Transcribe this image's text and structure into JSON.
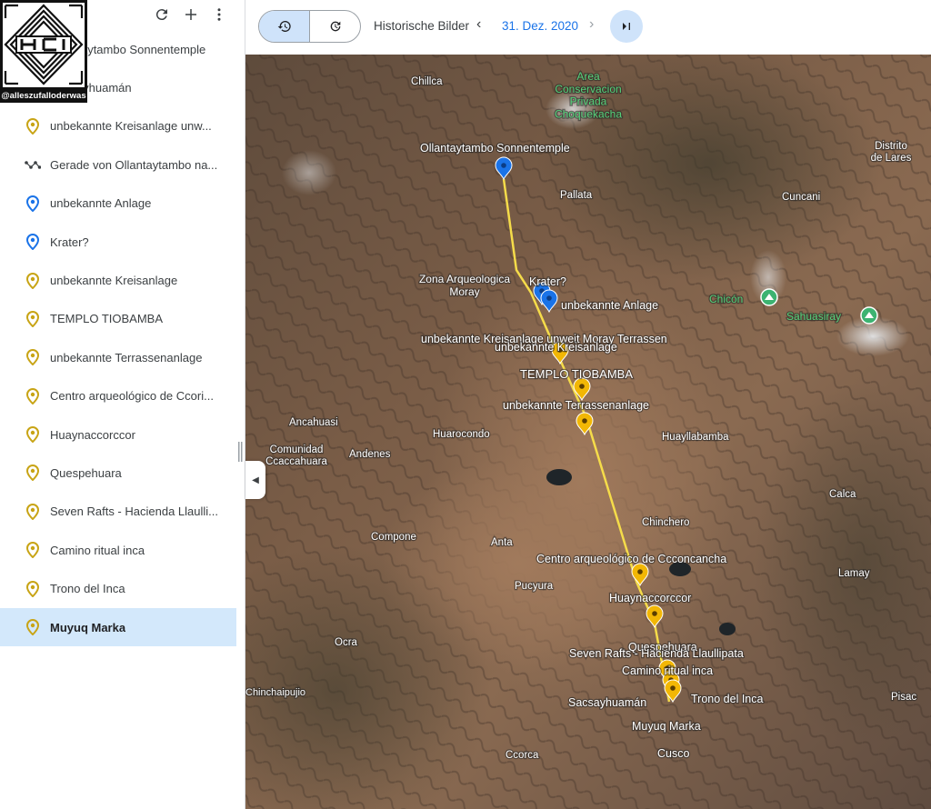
{
  "sidebar": {
    "toolbar": {
      "refresh_icon": "refresh-icon",
      "add_icon": "plus-icon",
      "more_icon": "more-vert-icon"
    },
    "items": [
      {
        "label": "Ollantaytambo Sonnentemple",
        "icon": "pin-icon",
        "color": "#c8a415"
      },
      {
        "label": "Sacsayhuamán",
        "icon": "pin-icon",
        "color": "#c8a415"
      },
      {
        "label": "unbekannte Kreisanlage unw...",
        "icon": "pin-icon",
        "color": "#c8a415"
      },
      {
        "label": "Gerade von Ollantaytambo na...",
        "icon": "path-icon",
        "color": "#3c4043"
      },
      {
        "label": "unbekannte Anlage",
        "icon": "pin-icon",
        "color": "#1a73e8"
      },
      {
        "label": "Krater?",
        "icon": "pin-icon",
        "color": "#1a73e8"
      },
      {
        "label": "unbekannte Kreisanlage",
        "icon": "pin-icon",
        "color": "#c8a415"
      },
      {
        "label": "TEMPLO TIOBAMBA",
        "icon": "pin-icon",
        "color": "#c8a415"
      },
      {
        "label": "unbekannte Terrassenanlage",
        "icon": "pin-icon",
        "color": "#c8a415"
      },
      {
        "label": "Centro arqueológico de Ccori...",
        "icon": "pin-icon",
        "color": "#c8a415"
      },
      {
        "label": "Huaynaccorccor",
        "icon": "pin-icon",
        "color": "#c8a415"
      },
      {
        "label": "Quespehuara",
        "icon": "pin-icon",
        "color": "#c8a415"
      },
      {
        "label": "Seven Rafts - Hacienda Llaulli...",
        "icon": "pin-icon",
        "color": "#c8a415"
      },
      {
        "label": "Camino ritual inca",
        "icon": "pin-icon",
        "color": "#c8a415"
      },
      {
        "label": "Trono del Inca",
        "icon": "pin-icon",
        "color": "#c8a415"
      },
      {
        "label": "Muyuq Marka",
        "icon": "pin-icon",
        "color": "#c8a415",
        "selected": true
      }
    ]
  },
  "watermark": {
    "handle": "@alleszufalloderwas"
  },
  "topbar": {
    "historical_label": "Historische Bilder",
    "date": "31. Dez. 2020",
    "prev_icon": "chevron-left-icon",
    "next_icon": "chevron-right-icon",
    "latest_icon": "skip-to-latest-icon",
    "seg_history_icon": "history-icon",
    "seg_timer_icon": "timer-icon"
  },
  "map": {
    "place_labels": {
      "chillca": "Chillca",
      "area": "Area Conservacion Privada Choquekacha",
      "distrito": "Distrito de Lares",
      "pallata": "Pallata",
      "cuncani": "Cuncani",
      "chicon": "Chicón",
      "sahuasiray": "Sahuasiray",
      "moray": "Zona Arqueologica Moray",
      "ancahuasi": "Ancahuasi",
      "huarocondo": "Huarocondo",
      "huayllabamba": "Huayllabamba",
      "comunidad": "Comunidad Ccaccahuara",
      "andenes": "Andenes",
      "calca": "Calca",
      "chinchero": "Chinchero",
      "compone": "Compone",
      "anta": "Anta",
      "lamay": "Lamay",
      "pucyura": "Pucyura",
      "ocra": "Ocra",
      "chinchaipujio": "Chinchaipujio",
      "pisac": "Pisac",
      "ccorca": "Ccorca",
      "cusco": "Cusco",
      "pisac_top": "Pisac"
    },
    "marker_labels": {
      "ollantaytambo": "Ollantaytambo Sonnentemple",
      "krater": "Krater?",
      "anlage": "unbekannte Anlage",
      "kreis_moray": "unbekannte Kreisanlage unweit Moray Terrassen",
      "kreis": "unbekannte Kreisanlage",
      "tiobamba": "TEMPLO TIOBAMBA",
      "terrassen": "unbekannte Terrassenanlage",
      "ccor": "Centro arqueológico de Ccconcancha",
      "huayna": "Huaynaccorccor",
      "quespe": "Quespehuara",
      "seven": "Seven Rafts - Hacienda Llaullipata",
      "camino": "Camino ritual inca",
      "sacsay": "Sacsayhuamán",
      "trono": "Trono del Inca",
      "muyuq": "Muyuq Marka"
    },
    "colors": {
      "line": "#f5dc4a",
      "gold_pin": "#f2b705",
      "blue_pin": "#1a73e8",
      "green_label": "#55d17a"
    }
  }
}
